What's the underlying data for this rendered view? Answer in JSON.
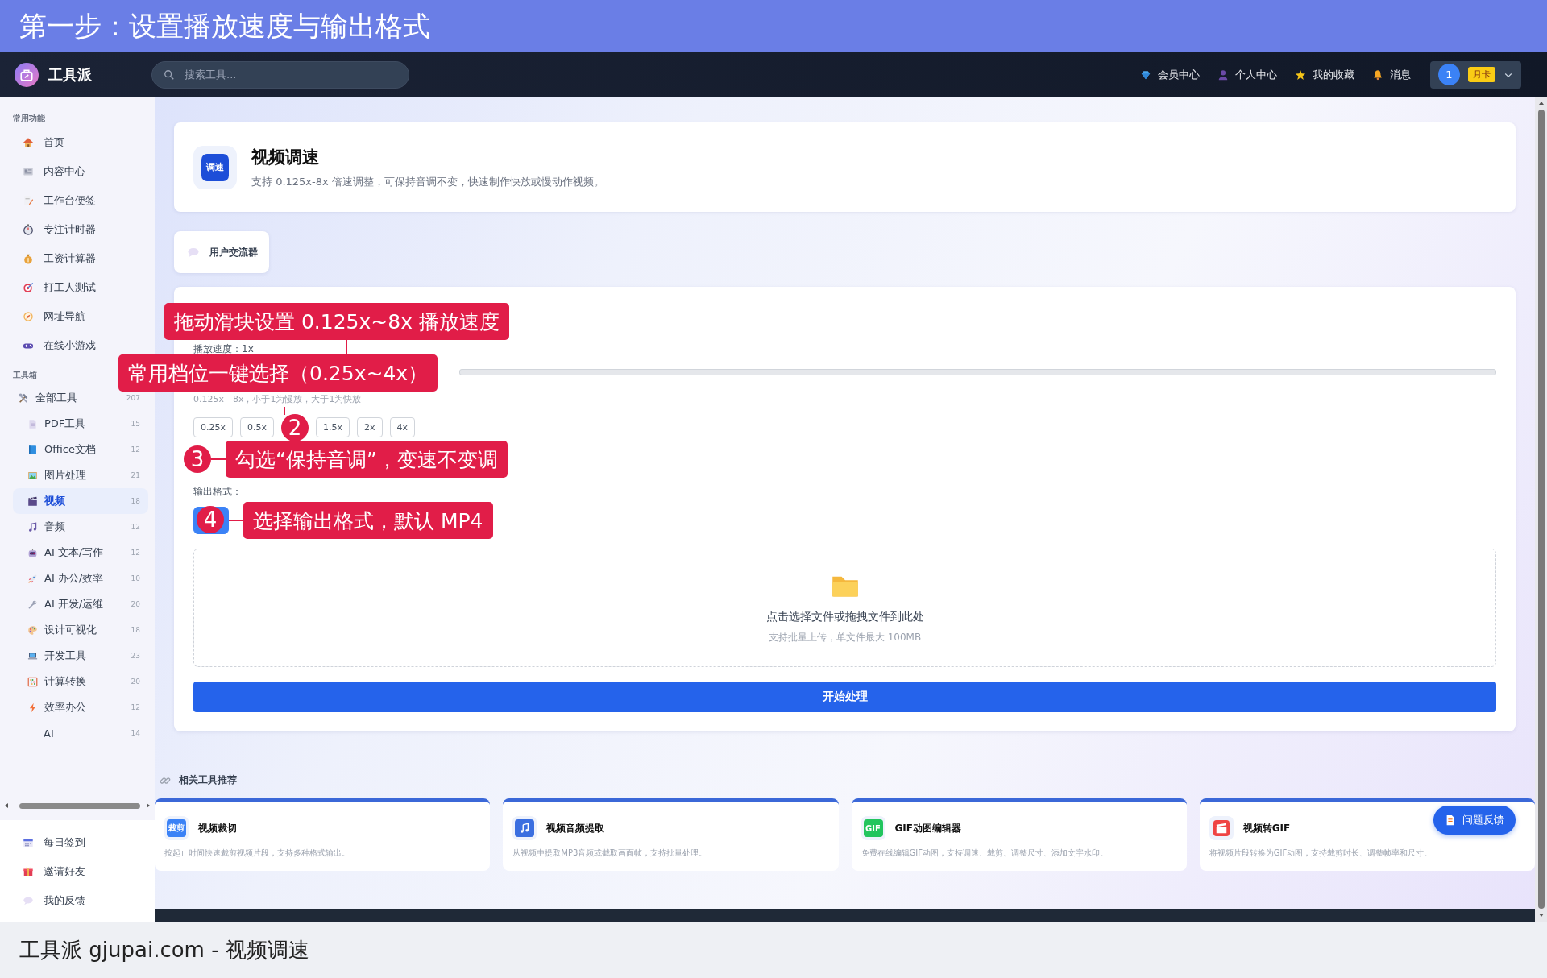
{
  "banner": {
    "title": "第一步：设置播放速度与输出格式"
  },
  "navbar": {
    "logo": "工具派",
    "search": {
      "placeholder": "搜索工具..."
    },
    "links": [
      {
        "label": "会员中心"
      },
      {
        "label": "个人中心"
      },
      {
        "label": "我的收藏"
      },
      {
        "label": "消息"
      }
    ],
    "user": {
      "avatar": "1",
      "badge": "月卡"
    }
  },
  "sidebar": {
    "common": {
      "title": "常用功能",
      "items": [
        {
          "label": "首页"
        },
        {
          "label": "内容中心"
        },
        {
          "label": "工作台便签"
        },
        {
          "label": "专注计时器"
        },
        {
          "label": "工资计算器"
        },
        {
          "label": "打工人测试"
        },
        {
          "label": "网址导航"
        },
        {
          "label": "在线小游戏"
        }
      ]
    },
    "toolbox": {
      "title": "工具箱",
      "all": {
        "label": "全部工具",
        "count": "207"
      },
      "items": [
        {
          "label": "PDF工具",
          "count": "15",
          "selected": false
        },
        {
          "label": "Office文档",
          "count": "12",
          "selected": false
        },
        {
          "label": "图片处理",
          "count": "21",
          "selected": false
        },
        {
          "label": "视频",
          "count": "18",
          "selected": true
        },
        {
          "label": "音频",
          "count": "12",
          "selected": false
        },
        {
          "label": "AI 文本/写作",
          "count": "12",
          "selected": false
        },
        {
          "label": "AI 办公/效率",
          "count": "10",
          "selected": false
        },
        {
          "label": "AI 开发/运维",
          "count": "20",
          "selected": false
        },
        {
          "label": "设计可视化",
          "count": "18",
          "selected": false
        },
        {
          "label": "开发工具",
          "count": "23",
          "selected": false
        },
        {
          "label": "计算转换",
          "count": "20",
          "selected": false
        },
        {
          "label": "效率办公",
          "count": "12",
          "selected": false
        },
        {
          "label": "AI",
          "count": "14",
          "selected": false
        }
      ]
    },
    "bottom": [
      {
        "label": "每日签到"
      },
      {
        "label": "邀请好友"
      },
      {
        "label": "我的反馈"
      }
    ]
  },
  "header": {
    "badge": "调速",
    "title": "视频调速",
    "description": "支持 0.125x-8x 倍速调整，可保持音调不变，快速制作快放或慢动作视频。"
  },
  "group_button": {
    "label": "用户交流群"
  },
  "panel": {
    "speed_label": "播放速度：1x",
    "hint": "0.125x - 8x，小于1为慢放，大于1为快放",
    "presets": [
      {
        "kind": "preset",
        "label": "0.25x"
      },
      {
        "kind": "preset",
        "label": "0.5x"
      },
      {
        "kind": "marker",
        "label": "2"
      },
      {
        "kind": "preset",
        "label": "1.5x"
      },
      {
        "kind": "preset",
        "label": "2x"
      },
      {
        "kind": "preset",
        "label": "4x"
      }
    ],
    "format_label": "输出格式：",
    "format_button": {
      "selected": true
    },
    "upload": {
      "title": "点击选择文件或拖拽文件到此处",
      "hint": "支持批量上传，单文件最大 100MB"
    },
    "start_button": {
      "label": "开始处理"
    }
  },
  "annotations": [
    {
      "text": "拖动滑块设置 0.125x~8x 播放速度"
    },
    {
      "text": "常用档位一键选择（0.25x~4x）"
    },
    {
      "marker": "3",
      "text": "勾选“保持音调”，变速不变调"
    },
    {
      "marker": "4",
      "text": "选择输出格式，默认 MP4"
    }
  ],
  "related": {
    "title": "相关工具推荐",
    "cards": [
      {
        "badge": "裁剪",
        "title": "视频裁切",
        "description": "按起止时间快速裁剪视频片段，支持多种格式输出。"
      },
      {
        "title": "视频音频提取",
        "description": "从视频中提取MP3音频或截取画面帧，支持批量处理。"
      },
      {
        "badge": "GIF",
        "title": "GIF动图编辑器",
        "description": "免费在线编辑GIF动图，支持调速、裁剪、调整尺寸、添加文字水印。"
      },
      {
        "title": "视频转GIF",
        "description": "将视频片段转换为GIF动图，支持裁剪时长、调整帧率和尺寸。"
      }
    ]
  },
  "feedback_button": {
    "label": "问题反馈"
  },
  "caption": "工具派 gjupai.com - 视频调速"
}
